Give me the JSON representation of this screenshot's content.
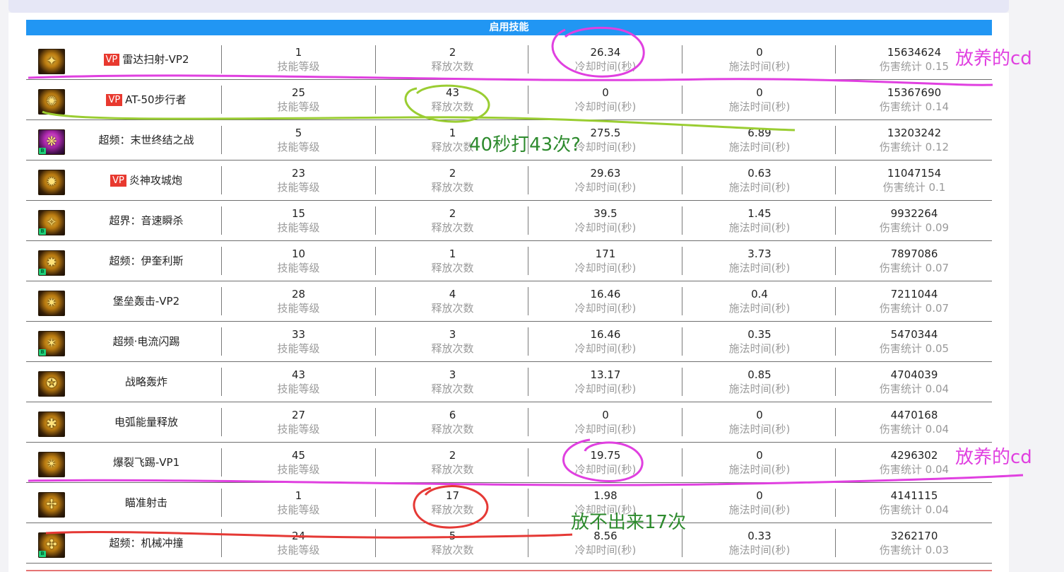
{
  "section_title": "启用技能",
  "labels": {
    "level": "技能等级",
    "casts": "释放次数",
    "cooldown": "冷却时间(秒)",
    "cast_time": "施法时间(秒)",
    "damage_prefix": "伤害统计"
  },
  "vp_tag": "VP",
  "skills": [
    {
      "name": "雷达扫射-VP2",
      "vp": true,
      "icon": "gold-radar-icon",
      "badge": "",
      "level": "1",
      "casts": "2",
      "cooldown": "26.34",
      "cast_time": "0",
      "damage": "15634624",
      "damage_stat": "伤害统计 0.15"
    },
    {
      "name": "AT-50步行者",
      "vp": true,
      "icon": "gold-walker-icon",
      "badge": "",
      "level": "25",
      "casts": "43",
      "cooldown": "0",
      "cast_time": "0",
      "damage": "15367690",
      "damage_stat": "伤害统计 0.14"
    },
    {
      "name": "超频：末世终结之战",
      "vp": false,
      "icon": "purple-explosion-icon",
      "badge": "B",
      "level": "5",
      "casts": "1",
      "cooldown": "275.5",
      "cast_time": "6.89",
      "damage": "13203242",
      "damage_stat": "伤害统计 0.12"
    },
    {
      "name": "炎神攻城炮",
      "vp": true,
      "icon": "gold-cannon-icon",
      "badge": "",
      "level": "23",
      "casts": "2",
      "cooldown": "29.63",
      "cast_time": "0.63",
      "damage": "11047154",
      "damage_stat": "伤害统计 0.1"
    },
    {
      "name": "超界：音速瞬杀",
      "vp": false,
      "icon": "gold-slash-icon",
      "badge": "B",
      "level": "15",
      "casts": "2",
      "cooldown": "39.5",
      "cast_time": "1.45",
      "damage": "9932264",
      "damage_stat": "伤害统计 0.09"
    },
    {
      "name": "超频：伊奎利斯",
      "vp": false,
      "icon": "gold-beam-icon",
      "badge": "B",
      "level": "10",
      "casts": "1",
      "cooldown": "171",
      "cast_time": "3.73",
      "damage": "7897086",
      "damage_stat": "伤害统计 0.07"
    },
    {
      "name": "堡垒轰击-VP2",
      "vp": false,
      "icon": "gold-fortress-icon",
      "badge": "",
      "level": "28",
      "casts": "4",
      "cooldown": "16.46",
      "cast_time": "0.4",
      "damage": "7211044",
      "damage_stat": "伤害统计 0.07"
    },
    {
      "name": "超频·电流闪踢",
      "vp": false,
      "icon": "gold-kick-icon",
      "badge": "B",
      "level": "33",
      "casts": "3",
      "cooldown": "16.46",
      "cast_time": "0.35",
      "damage": "5470344",
      "damage_stat": "伤害统计 0.05"
    },
    {
      "name": "战略轰炸",
      "vp": false,
      "icon": "gold-bomb-icon",
      "badge": "",
      "level": "43",
      "casts": "3",
      "cooldown": "13.17",
      "cast_time": "0.85",
      "damage": "4704039",
      "damage_stat": "伤害统计 0.04"
    },
    {
      "name": "电弧能量释放",
      "vp": false,
      "icon": "gold-arc-icon",
      "badge": "",
      "level": "27",
      "casts": "6",
      "cooldown": "0",
      "cast_time": "0",
      "damage": "4470168",
      "damage_stat": "伤害统计 0.04"
    },
    {
      "name": "爆裂飞踢-VP1",
      "vp": false,
      "icon": "gold-burst-icon",
      "badge": "",
      "level": "45",
      "casts": "2",
      "cooldown": "19.75",
      "cast_time": "0",
      "damage": "4296302",
      "damage_stat": "伤害统计 0.04"
    },
    {
      "name": "瞄准射击",
      "vp": false,
      "icon": "gold-aim-icon",
      "badge": "",
      "level": "1",
      "casts": "17",
      "cooldown": "1.98",
      "cast_time": "0",
      "damage": "4141115",
      "damage_stat": "伤害统计 0.04"
    },
    {
      "name": "超频：机械冲撞",
      "vp": false,
      "icon": "gold-ram-icon",
      "badge": "B",
      "level": "24",
      "casts": "5",
      "cooldown": "8.56",
      "cast_time": "0.33",
      "damage": "3262170",
      "damage_stat": "伤害统计 0.03"
    }
  ],
  "annotations": {
    "cd_note_1": "放养的cd",
    "casts_note": "40秒打43次?",
    "cd_note_2": "放养的cd",
    "fail_note": "放不出来17次",
    "colors": {
      "magenta": "#e040e0",
      "green": "#2e8b2e",
      "lime": "#9acd32",
      "red": "#e53935"
    }
  }
}
